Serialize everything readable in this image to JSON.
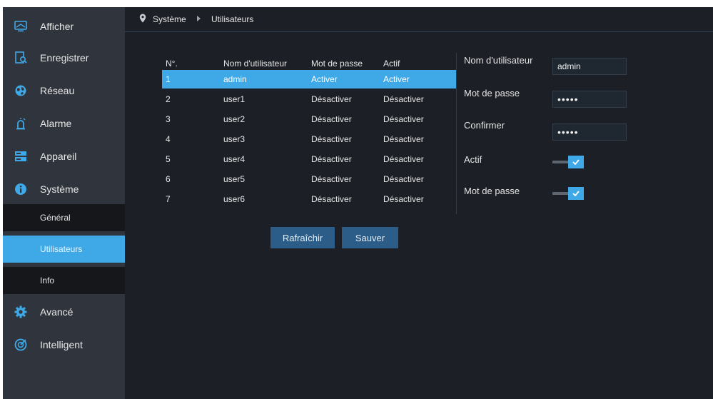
{
  "sidebar": {
    "items": [
      {
        "label": "Afficher",
        "icon": "monitor-icon"
      },
      {
        "label": "Enregistrer",
        "icon": "recording-search-icon"
      },
      {
        "label": "Réseau",
        "icon": "network-globe-icon"
      },
      {
        "label": "Alarme",
        "icon": "alarm-siren-icon"
      },
      {
        "label": "Appareil",
        "icon": "device-storage-icon"
      },
      {
        "label": "Système",
        "icon": "info-icon"
      },
      {
        "label": "Avancé",
        "icon": "gear-icon"
      },
      {
        "label": "Intelligent",
        "icon": "intelligent-analytics-icon"
      }
    ],
    "system_subitems": [
      {
        "label": "Général"
      },
      {
        "label": "Utilisateurs",
        "active": true
      },
      {
        "label": "Info"
      }
    ]
  },
  "breadcrumb": {
    "root": "Système",
    "current": "Utilisateurs"
  },
  "users_table": {
    "headers": [
      "N°.",
      "Nom d'utilisateur",
      "Mot de passe",
      "Actif"
    ],
    "rows": [
      [
        "1",
        "admin",
        "Activer",
        "Activer"
      ],
      [
        "2",
        "user1",
        "Désactiver",
        "Désactiver"
      ],
      [
        "3",
        "user2",
        "Désactiver",
        "Désactiver"
      ],
      [
        "4",
        "user3",
        "Désactiver",
        "Désactiver"
      ],
      [
        "5",
        "user4",
        "Désactiver",
        "Désactiver"
      ],
      [
        "6",
        "user5",
        "Désactiver",
        "Désactiver"
      ],
      [
        "7",
        "user6",
        "Désactiver",
        "Désactiver"
      ]
    ],
    "selected_row": 0
  },
  "form": {
    "username_label": "Nom d'utilisateur",
    "username_value": "admin",
    "password_label": "Mot de passe",
    "password_value": "•••••",
    "confirm_label": "Confirmer",
    "confirm_value": "•••••",
    "active_label": "Actif",
    "active_checked": true,
    "password_toggle_label": "Mot de passe",
    "password_toggle_checked": true
  },
  "buttons": {
    "refresh": "Rafraîchir",
    "save": "Sauver"
  },
  "colors": {
    "accent": "#3fa9e8",
    "sidebar": "#30343c",
    "content_bg": "#1c1f25",
    "button": "#2b5d88"
  }
}
